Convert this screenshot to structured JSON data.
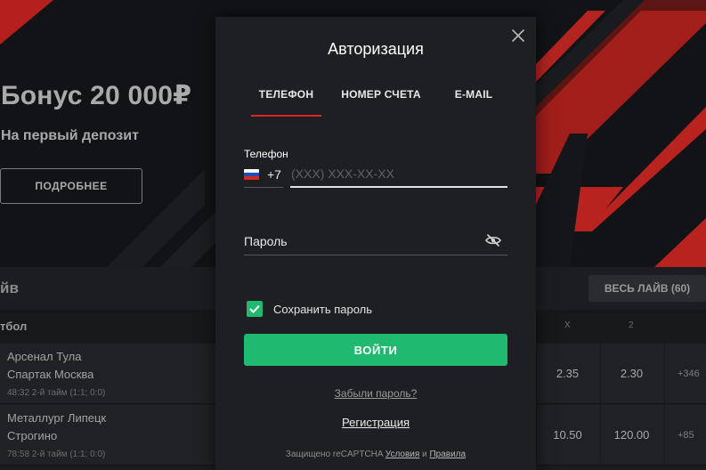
{
  "hero": {
    "title": "Бонус 20 000₽",
    "subtitle": "На первый депозит",
    "button_label": "ПОДРОБНЕЕ"
  },
  "live": {
    "title": "йв",
    "all_button": "ВЕСЬ ЛАЙВ (60)",
    "sport": "тбол",
    "columns": [
      "X",
      "2"
    ],
    "matches": [
      {
        "team1": "Арсенал Тула",
        "team2": "Спартак Москва",
        "status": "48:32 2-й тайм (1:1; 0:0)",
        "odd_x": "2.35",
        "odd_2": "2.30",
        "more": "+346"
      },
      {
        "team1": "Металлург Липецк",
        "team2": "Строгино",
        "status": "78:58 2-й тайм (1:1; 0:0)",
        "odd_x": "10.50",
        "odd_2": "120.00",
        "more": "+85"
      }
    ]
  },
  "modal": {
    "title": "Авторизация",
    "tabs": [
      {
        "label": "ТЕЛЕФОН",
        "active": true
      },
      {
        "label": "НОМЕР СЧЕТА",
        "active": false
      },
      {
        "label": "E-MAIL",
        "active": false
      }
    ],
    "phone_label": "Телефон",
    "country_code": "+7",
    "phone_placeholder": "(XXX) XXX-XX-XX",
    "phone_value": "",
    "password_placeholder": "Пароль",
    "password_value": "",
    "remember_label": "Сохранить пароль",
    "remember_checked": true,
    "login_button": "ВОЙТИ",
    "forgot_link": "Забыли пароль?",
    "register_link": "Регистрация",
    "captcha_prefix": "Защищено reCAPTCHA",
    "captcha_terms": "Условия",
    "captcha_and": "и",
    "captcha_privacy": "Правила"
  },
  "colors": {
    "accent_red": "#d9262a",
    "accent_green": "#1fb96f",
    "modal_bg": "#1e1f22"
  },
  "icons": {
    "close": "close-icon",
    "eye": "eye-slash-icon",
    "check": "check-icon",
    "flag": "russia-flag-icon"
  }
}
